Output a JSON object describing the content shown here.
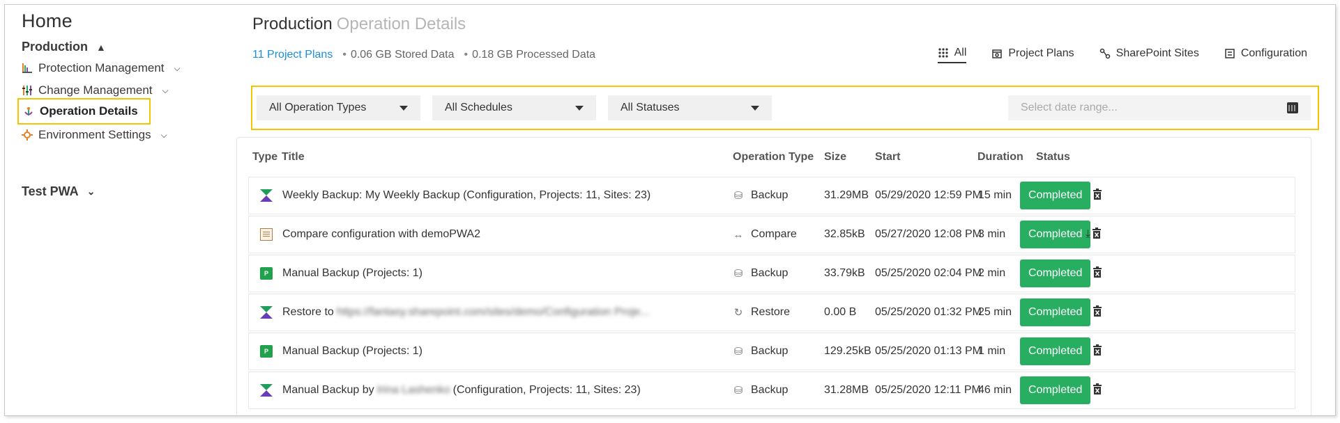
{
  "sidebar": {
    "home": "Home",
    "environments": [
      {
        "label": "Production",
        "chevron": "▲"
      },
      {
        "label": "Test PWA",
        "chevron": "⌄"
      }
    ],
    "items": [
      {
        "label": "Protection Management",
        "icon": "protection-management-icon"
      },
      {
        "label": "Change Management",
        "icon": "change-management-icon"
      },
      {
        "label": "Operation Details",
        "icon": "operation-details-icon"
      },
      {
        "label": "Environment Settings",
        "icon": "environment-settings-icon"
      }
    ]
  },
  "header": {
    "title": "Production",
    "subtitle": "Operation Details",
    "stats": {
      "plans": "11 Project Plans",
      "stored": "0.06 GB Stored Data",
      "processed": "0.18 GB Processed Data"
    },
    "tabs": [
      "All",
      "Project Plans",
      "SharePoint Sites",
      "Configuration"
    ]
  },
  "filters": {
    "operation_types": "All Operation Types",
    "schedules": "All Schedules",
    "statuses": "All Statuses",
    "date_placeholder": "Select date range..."
  },
  "table": {
    "columns": [
      "Type",
      "Title",
      "Operation Type",
      "Size",
      "Start",
      "Duration",
      "Status"
    ],
    "rows": [
      {
        "type_icon": "multi-backup-icon",
        "title": "Weekly Backup: My Weekly Backup (Configuration, Projects: 11, Sites: 23)",
        "op_icon": "backup-icon",
        "op": "Backup",
        "size": "31.29MB",
        "start": "05/29/2020 12:59 PM",
        "duration": "15 min",
        "status": "Completed"
      },
      {
        "type_icon": "document-icon",
        "title": "Compare configuration with demoPWA2",
        "op_icon": "compare-icon",
        "op": "Compare",
        "size": "32.85kB",
        "start": "05/27/2020 12:08 PM",
        "duration": "3 min",
        "status": "Completed"
      },
      {
        "type_icon": "project-icon",
        "title": "Manual Backup (Projects: 1)",
        "op_icon": "backup-icon",
        "op": "Backup",
        "size": "33.79kB",
        "start": "05/25/2020 02:04 PM",
        "duration": "2 min",
        "status": "Completed"
      },
      {
        "type_icon": "multi-backup-icon",
        "title": "Restore to",
        "title_blur": "https://fantasy.sharepoint.com/sites/demo/Configuration Proje...",
        "op_icon": "restore-icon",
        "op": "Restore",
        "size": "0.00 B",
        "start": "05/25/2020 01:32 PM",
        "duration": "25 min",
        "status": "Completed"
      },
      {
        "type_icon": "project-icon",
        "title": "Manual Backup (Projects: 1)",
        "op_icon": "backup-icon",
        "op": "Backup",
        "size": "129.25kB",
        "start": "05/25/2020 01:13 PM",
        "duration": "1 min",
        "status": "Completed"
      },
      {
        "type_icon": "multi-backup-icon",
        "title": "Manual Backup by",
        "title_blur": "Irina Lashenko",
        "title_suffix": "(Configuration, Projects: 11, Sites: 23)",
        "op_icon": "backup-icon",
        "op": "Backup",
        "size": "31.28MB",
        "start": "05/25/2020 12:11 PM",
        "duration": "46 min",
        "status": "Completed"
      }
    ]
  }
}
